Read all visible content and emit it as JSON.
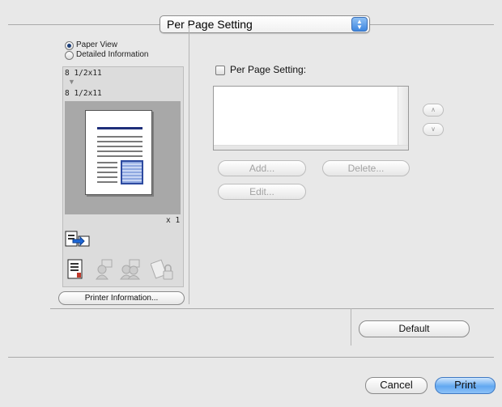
{
  "header": {
    "popup_value": "Per Page Setting"
  },
  "left_panel": {
    "view_options": [
      {
        "label": "Paper View",
        "selected": true
      },
      {
        "label": "Detailed Information",
        "selected": false
      }
    ],
    "source_size": "8 1/2x11",
    "output_size": "8 1/2x11",
    "copies_label": "x 1",
    "printer_info_label": "Printer Information..."
  },
  "right_panel": {
    "per_page_checkbox_label": "Per Page Setting:",
    "per_page_checked": false,
    "up_label": "∧",
    "down_label": "∨",
    "add_label": "Add...",
    "delete_label": "Delete...",
    "edit_label": "Edit..."
  },
  "footer": {
    "default_label": "Default",
    "cancel_label": "Cancel",
    "print_label": "Print"
  },
  "colors": {
    "accent": "#62a8f1",
    "window_bg": "#e8e8e8"
  },
  "icons": [
    "output-icon",
    "booklet-icon",
    "user-auth-icon",
    "account-track-icon",
    "secure-print-icon"
  ]
}
